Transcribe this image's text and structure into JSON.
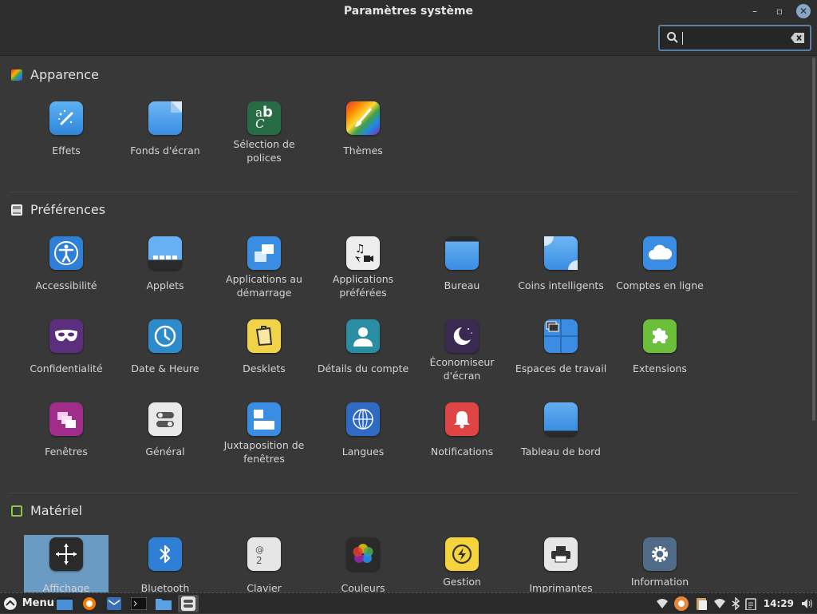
{
  "window": {
    "title": "Paramètres système",
    "minimize": "–",
    "restore": "▫",
    "close": "✕"
  },
  "search": {
    "value": "",
    "placeholder": ""
  },
  "sections": [
    {
      "title": "Apparence",
      "items": [
        "Effets",
        "Fonds d'écran",
        "Sélection de polices",
        "Thèmes"
      ]
    },
    {
      "title": "Préférences",
      "items": [
        "Accessibilité",
        "Applets",
        "Applications au démarrage",
        "Applications préférées",
        "Bureau",
        "Coins intelligents",
        "Comptes en ligne",
        "Confidentialité",
        "Date & Heure",
        "Desklets",
        "Détails du compte",
        "Économiseur d'écran",
        "Espaces de travail",
        "Extensions",
        "Fenêtres",
        "Général",
        "Juxtaposition de fenêtres",
        "Langues",
        "Notifications",
        "Tableau de bord"
      ]
    },
    {
      "title": "Matériel",
      "items": [
        "Affichage",
        "Bluetooth",
        "Clavier",
        "Couleurs",
        "Gestion",
        "Imprimantes",
        "Information"
      ]
    }
  ],
  "labels": {
    "effets": "Effets",
    "fonds": "Fonds d'écran",
    "polices_1": "Sélection de",
    "polices_2": "polices",
    "themes": "Thèmes",
    "accessibilite": "Accessibilité",
    "applets": "Applets",
    "demarrage_1": "Applications au",
    "demarrage_2": "démarrage",
    "preferees_1": "Applications",
    "preferees_2": "préférées",
    "bureau": "Bureau",
    "coins": "Coins intelligents",
    "comptes": "Comptes en ligne",
    "confidentialite": "Confidentialité",
    "date": "Date & Heure",
    "desklets": "Desklets",
    "details": "Détails du compte",
    "economiseur_1": "Économiseur",
    "economiseur_2": "d'écran",
    "espaces": "Espaces de travail",
    "extensions": "Extensions",
    "fenetres": "Fenêtres",
    "general": "Général",
    "juxta_1": "Juxtaposition de",
    "juxta_2": "fenêtres",
    "langues": "Langues",
    "notifications": "Notifications",
    "tableau": "Tableau de bord",
    "affichage": "Affichage",
    "bluetooth": "Bluetooth",
    "clavier": "Clavier",
    "couleurs": "Couleurs",
    "gestion": "Gestion",
    "imprimantes": "Imprimantes",
    "information": "Information"
  },
  "selected_item": "Affichage",
  "taskbar": {
    "menu_label": "Menu",
    "clock": "14:29"
  },
  "colors": {
    "accent": "#6b9bc3",
    "background": "#383838",
    "titlebar": "#2e2e2e"
  }
}
